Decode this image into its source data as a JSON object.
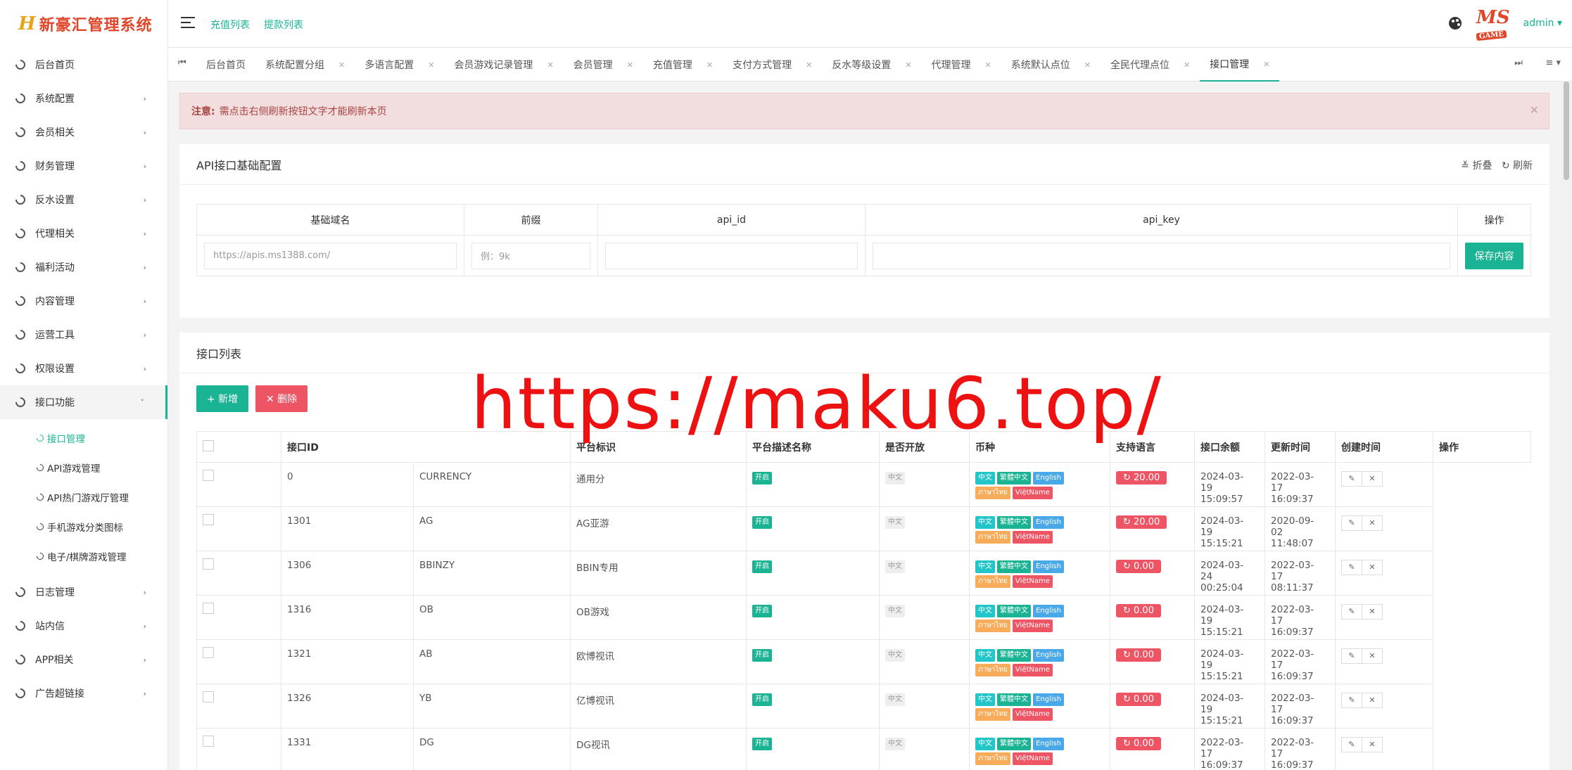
{
  "app": {
    "logo_mark": "H",
    "logo_text": "新豪汇管理系统"
  },
  "sidebar": {
    "items": [
      {
        "label": "后台首页"
      },
      {
        "label": "系统配置"
      },
      {
        "label": "会员相关"
      },
      {
        "label": "财务管理"
      },
      {
        "label": "反水设置"
      },
      {
        "label": "代理相关"
      },
      {
        "label": "福利活动"
      },
      {
        "label": "内容管理"
      },
      {
        "label": "运营工具"
      },
      {
        "label": "权限设置"
      },
      {
        "label": "接口功能"
      }
    ],
    "sub_items": [
      {
        "label": "接口管理"
      },
      {
        "label": "API游戏管理"
      },
      {
        "label": "API热门游戏厅管理"
      },
      {
        "label": "手机游戏分类图标"
      },
      {
        "label": "电子/棋牌游戏管理"
      }
    ],
    "items_after": [
      {
        "label": "日志管理"
      },
      {
        "label": "站内信"
      },
      {
        "label": "APP相关"
      },
      {
        "label": "广告超链接"
      }
    ]
  },
  "topbar": {
    "link1": "充值列表",
    "link2": "提款列表",
    "avatar_text": "MS",
    "avatar_sub": "GAME",
    "user": "admin ▾"
  },
  "tabs": [
    "后台首页",
    "系统配置分组",
    "多语言配置",
    "会员游戏记录管理",
    "会员管理",
    "充值管理",
    "支付方式管理",
    "反水等级设置",
    "代理管理",
    "系统默认点位",
    "全民代理点位",
    "接口管理"
  ],
  "alert": {
    "title": "注意:",
    "text": "需点击右侧刷新按钮文字才能刷新本页"
  },
  "config_panel": {
    "title": "API接口基础配置",
    "collapse": "≚ 折叠",
    "refresh": "↻ 刷新",
    "headers": [
      "基础域名",
      "前缀",
      "api_id",
      "api_key",
      "操作"
    ],
    "domain_placeholder": "https://apis.ms1388.com/",
    "prefix_placeholder": "例：9k",
    "save": "保存内容"
  },
  "list_panel": {
    "title": "接口列表",
    "add": "+ 新增",
    "delete": "✕ 删除",
    "headers": [
      "接口ID",
      "平台标识",
      "平台描述名称",
      "是否开放",
      "币种",
      "支持语言",
      "接口余额",
      "更新时间",
      "创建时间",
      "操作"
    ],
    "lang": [
      "中文",
      "繁體中文",
      "English",
      "ภาษาไทย",
      "ViệtName"
    ],
    "open": "开启",
    "currency": "中文",
    "rows": [
      {
        "id": "0",
        "code": "CURRENCY",
        "name": "通用分",
        "balance": "↻ 20.00",
        "updated": "2024-03-19 15:09:57",
        "created": "2022-03-17 16:09:37"
      },
      {
        "id": "1301",
        "code": "AG",
        "name": "AG亚游",
        "balance": "↻ 20.00",
        "updated": "2024-03-19 15:15:21",
        "created": "2020-09-02 11:48:07"
      },
      {
        "id": "1306",
        "code": "BBINZY",
        "name": "BBIN专用",
        "balance": "↻ 0.00",
        "updated": "2024-03-24 00:25:04",
        "created": "2022-03-17 08:11:37"
      },
      {
        "id": "1316",
        "code": "OB",
        "name": "OB游戏",
        "balance": "↻ 0.00",
        "updated": "2024-03-19 15:15:21",
        "created": "2022-03-17 16:09:37"
      },
      {
        "id": "1321",
        "code": "AB",
        "name": "欧博视讯",
        "balance": "↻ 0.00",
        "updated": "2024-03-19 15:15:21",
        "created": "2022-03-17 16:09:37"
      },
      {
        "id": "1326",
        "code": "YB",
        "name": "亿博视讯",
        "balance": "↻ 0.00",
        "updated": "2024-03-19 15:15:21",
        "created": "2022-03-17 16:09:37"
      },
      {
        "id": "1331",
        "code": "DG",
        "name": "DG视讯",
        "balance": "↻ 0.00",
        "updated": "2022-03-17 16:09:37",
        "created": "2022-03-17 16:09:37"
      }
    ]
  },
  "watermark": "https://maku6.top/",
  "colors": {
    "accent": "#1ab394",
    "danger": "#ed5565",
    "alert_bg": "#f2dede",
    "watermark": "#ee1111"
  }
}
